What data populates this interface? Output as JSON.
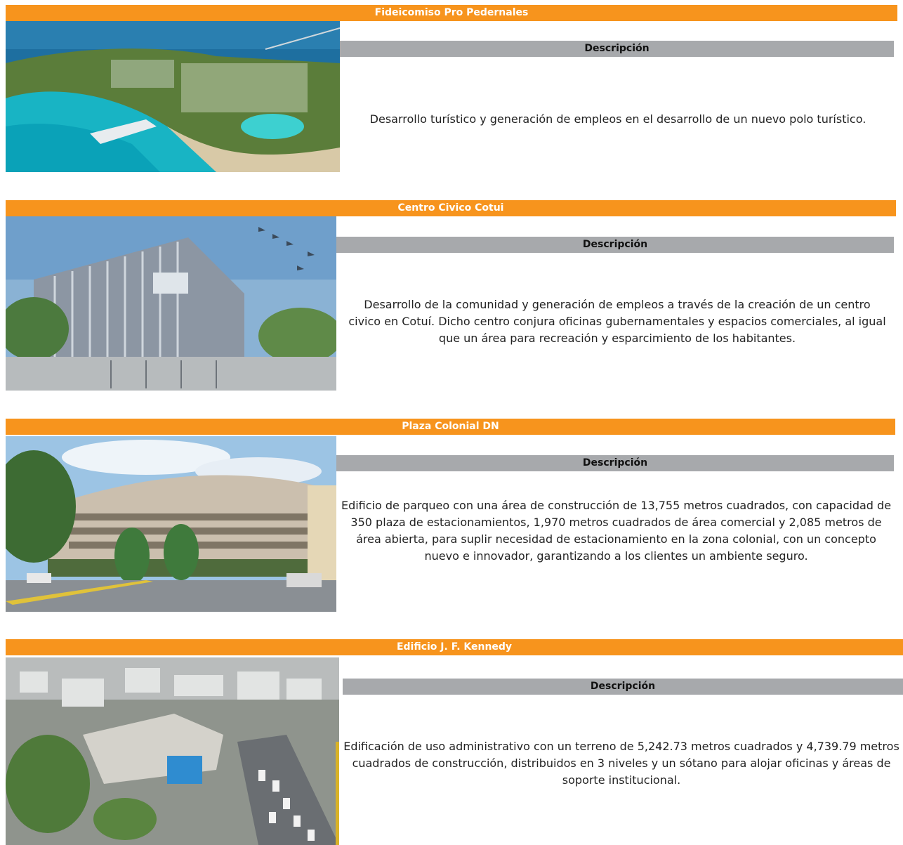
{
  "projects": [
    {
      "title": "Fideicomiso Pro Pedernales",
      "image": "aerial-resort-coastline-image",
      "desc_header": "Descripción",
      "description": "Desarrollo turístico y generación de empleos en el desarrollo de un nuevo polo turístico."
    },
    {
      "title": "Centro Civico Cotui",
      "image": "civic-center-building-image",
      "desc_header": "Descripción",
      "description": "Desarrollo de la comunidad y generación de empleos a través de la creación de un centro civico en Cotuí. Dicho centro conjura oficinas gubernamentales y espacios comerciales, al igual que un área para recreación y esparcimiento de los habitantes."
    },
    {
      "title": "Plaza Colonial DN",
      "image": "parking-building-image",
      "desc_header": "Descripción",
      "description": "Edificio de parqueo con una área de construcción de 13,755 metros cuadrados, con capacidad de 350 plaza de estacionamientos, 1,970 metros cuadrados de área comercial y 2,085 metros de área abierta, para suplir necesidad de estacionamiento en la zona colonial, con un concepto nuevo e innovador, garantizando a los clientes un ambiente seguro."
    },
    {
      "title": "Edificio J. F. Kennedy",
      "image": "aerial-city-building-image",
      "desc_header": "Descripción",
      "description": "Edificación de uso administrativo con un terreno de 5,242.73 metros cuadrados y 4,739.79 metros cuadrados de construcción, distribuidos en 3 niveles y un sótano para alojar oficinas y áreas de soporte institucional."
    }
  ],
  "colors": {
    "title_bar": "#f7941d",
    "desc_bar": "#a7a9ac"
  }
}
